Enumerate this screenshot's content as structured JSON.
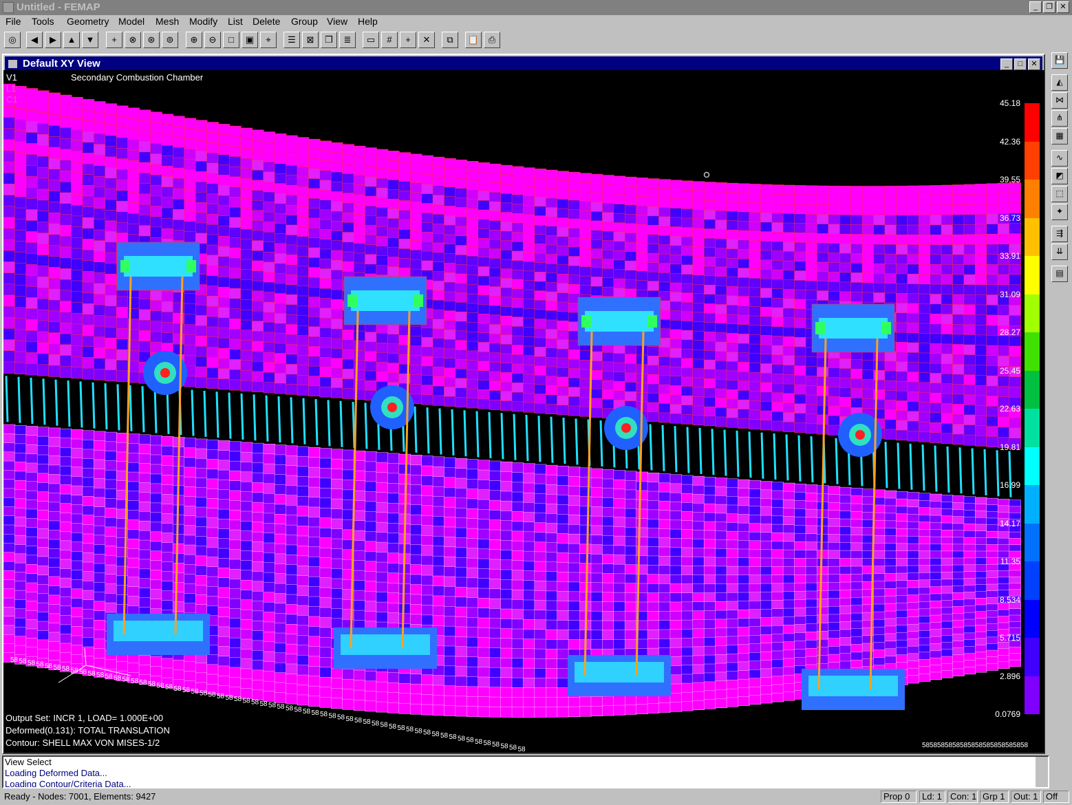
{
  "app": {
    "title": "Untitled - FEMAP"
  },
  "menu": [
    "File",
    "Tools",
    "Geometry",
    "Model",
    "Mesh",
    "Modify",
    "List",
    "Delete",
    "Group",
    "View",
    "Help"
  ],
  "view_window": {
    "title": "Default XY View",
    "view_id": "V1",
    "layer_id": "L1",
    "color_id": "C1",
    "subtitle": "Secondary Combustion Chamber"
  },
  "legend": {
    "values": [
      "45.18",
      "42.36",
      "39.55",
      "36.73",
      "33.91",
      "31.09",
      "28.27",
      "25.45",
      "22.63",
      "19.81",
      "16.99",
      "14.17",
      "11.35",
      "8.534",
      "5.715",
      "2.896",
      "0.0769"
    ],
    "colors": [
      "#ff0000",
      "#ff4000",
      "#ff8000",
      "#ffc000",
      "#ffff00",
      "#a0ff00",
      "#40e000",
      "#00c040",
      "#00e0a0",
      "#00ffff",
      "#00b0ff",
      "#0070ff",
      "#0040ff",
      "#0000ff",
      "#4000ff",
      "#8000ff",
      "#ff00ff"
    ]
  },
  "result_info": {
    "output_set": "Output Set: INCR 1, LOAD= 1.000E+00",
    "deformed": "Deformed(0.131): TOTAL TRANSLATION",
    "contour": "Contour: SHELL MAX VON MISES-1/2"
  },
  "constraint_marker": "58",
  "messages": [
    "View Select",
    "Loading Deformed Data...",
    "Loading Contour/Criteria Data..."
  ],
  "status": {
    "main": "Ready - Nodes: 7001,  Elements: 9427",
    "prop": "Prop 0",
    "ld": "Ld: 1",
    "con": "Con: 1",
    "grp": "Grp 1",
    "out": "Out: 1",
    "off": "Off"
  },
  "toolbar_icons": [
    "select-icon",
    "arrow-left-icon",
    "arrow-right-icon",
    "arrow-up-icon",
    "arrow-down-icon",
    "plus-icon",
    "rotate-x-icon",
    "rotate-y-icon",
    "rotate-z-icon",
    "zoom-in-icon",
    "zoom-out-icon",
    "zoom-box-icon",
    "zoom-window-icon",
    "center-icon",
    "list-icon",
    "box-icon",
    "cube-icon",
    "layers-icon",
    "window-icon",
    "grid-icon",
    "plus-snap-icon",
    "close-x-icon",
    "copy-icon",
    "paste-icon",
    "print-icon"
  ]
}
